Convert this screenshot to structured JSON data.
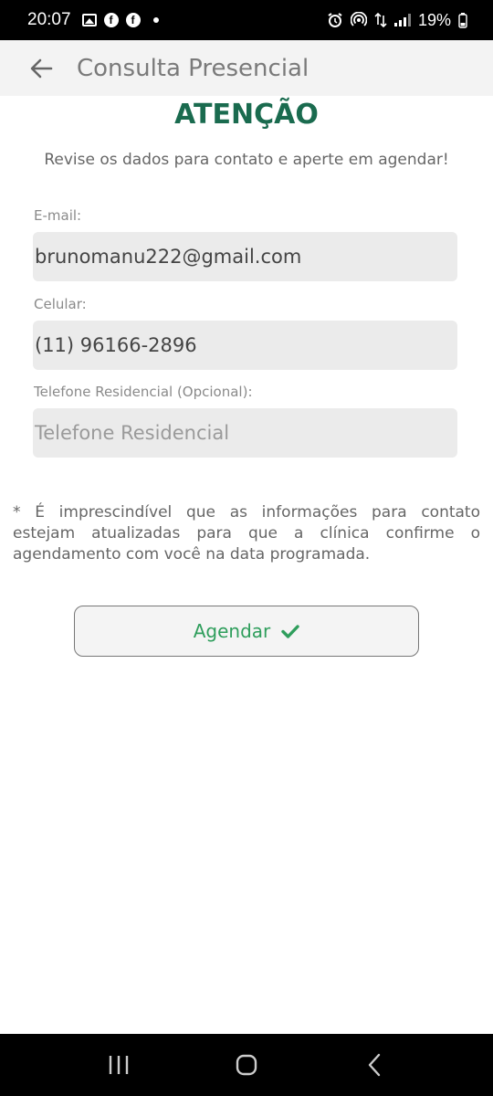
{
  "status_bar": {
    "time": "20:07",
    "battery": "19%",
    "icons": [
      "image-icon",
      "facebook-icon",
      "facebook-icon",
      "notification-dot",
      "alarm-icon",
      "hotspot-icon",
      "data-arrows-icon",
      "signal-icon",
      "battery-icon"
    ]
  },
  "app_bar": {
    "title": "Consulta Presencial",
    "back_icon": "arrow-left-icon"
  },
  "content": {
    "heading": "ATENÇÃO",
    "subtitle": "Revise os dados para contato e aperte em agendar!",
    "fields": [
      {
        "label": "E-mail:",
        "value": "brunomanu222@gmail.com",
        "placeholder": ""
      },
      {
        "label": "Celular:",
        "value": "(11) 96166-2896",
        "placeholder": ""
      },
      {
        "label": "Telefone Residencial (Opcional):",
        "value": "",
        "placeholder": "Telefone Residencial"
      }
    ],
    "notice": "* É imprescindível que as informações para contato estejam atualizadas para que a clínica confirme o agendamento com você na data programada.",
    "button_label": "Agendar"
  },
  "colors": {
    "heading": "#1a6b4f",
    "button_text": "#2f9e5c",
    "input_bg": "#ebebeb",
    "app_bar_bg": "#f3f3f3"
  },
  "nav_bar": {
    "icons": [
      "recent-apps-icon",
      "home-icon",
      "back-icon"
    ]
  }
}
